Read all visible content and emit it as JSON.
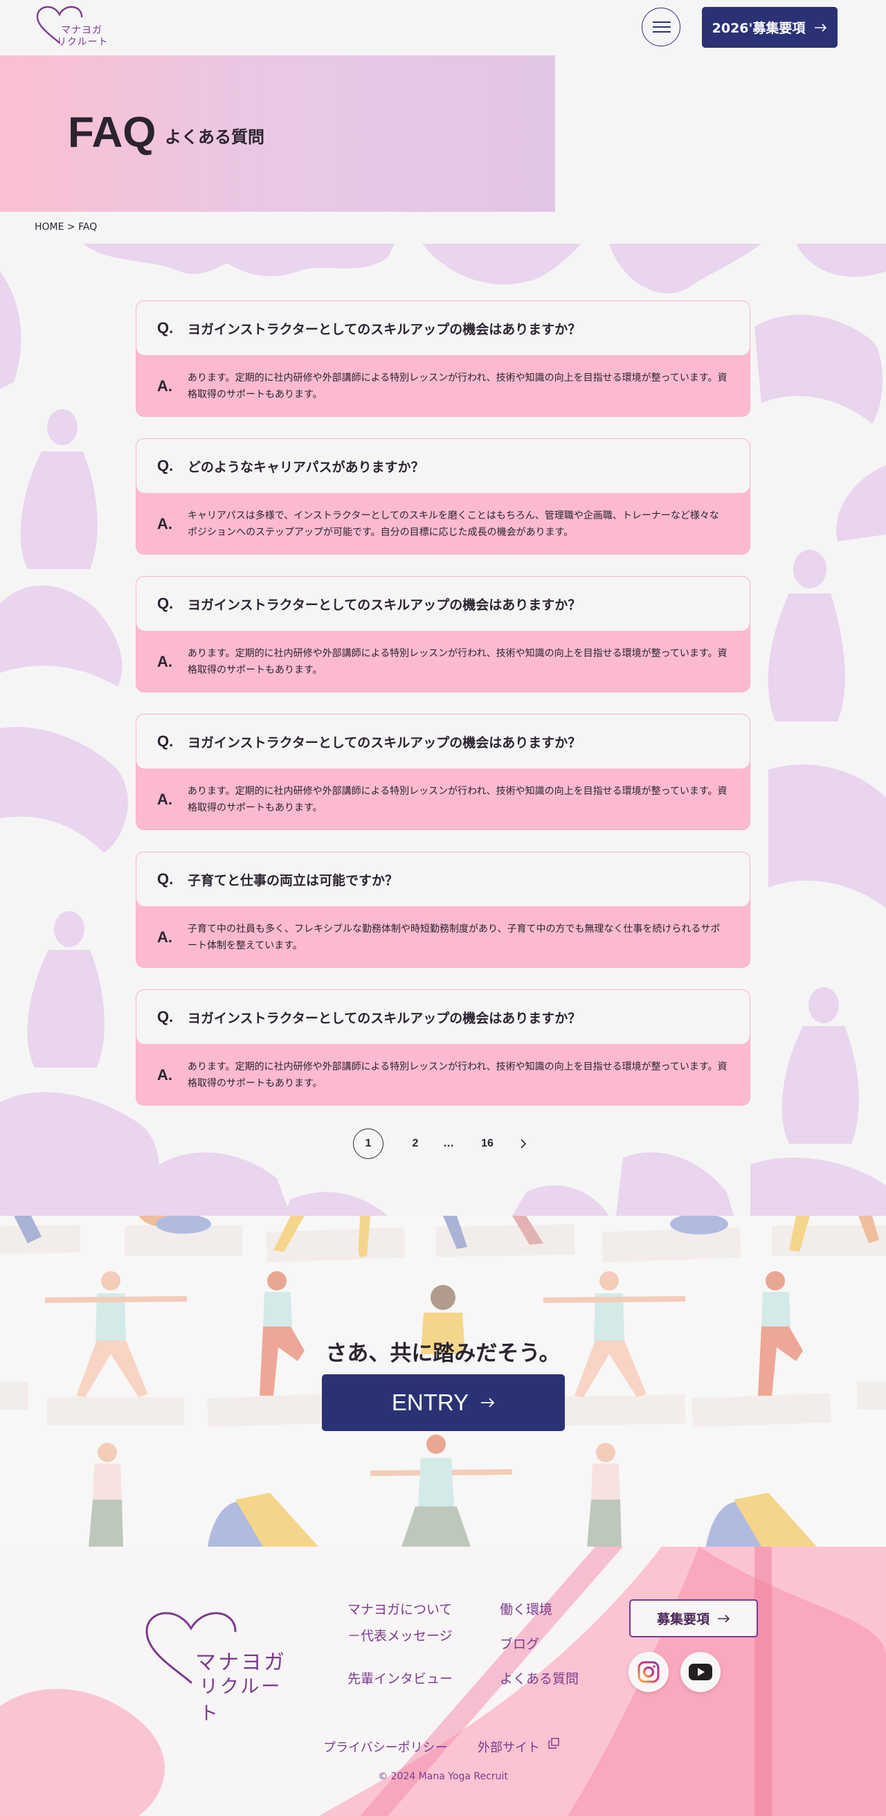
{
  "header": {
    "logo_text_line1": "マナヨガ",
    "logo_text_line2": "リクルート",
    "cta_label": "2026'募集要項"
  },
  "hero": {
    "title": "FAQ",
    "subtitle": "よくある質問"
  },
  "breadcrumb": "HOME > FAQ",
  "faq": [
    {
      "q_mark": "Q.",
      "question": "ヨガインストラクターとしてのスキルアップの機会はありますか？",
      "a_mark": "A.",
      "answer": "あります。定期的に社内研修や外部講師による特別レッスンが行われ、技術や知識の向上を目指せる環境が整っています。資格取得のサポートもあります。"
    },
    {
      "q_mark": "Q.",
      "question": "どのようなキャリアパスがありますか？",
      "a_mark": "A.",
      "answer": "キャリアパスは多様で、インストラクターとしてのスキルを磨くことはもちろん、管理職や企画職、トレーナーなど様々なポジションへのステップアップが可能です。自分の目標に応じた成長の機会があります。"
    },
    {
      "q_mark": "Q.",
      "question": "ヨガインストラクターとしてのスキルアップの機会はありますか？",
      "a_mark": "A.",
      "answer": "あります。定期的に社内研修や外部講師による特別レッスンが行われ、技術や知識の向上を目指せる環境が整っています。資格取得のサポートもあります。"
    },
    {
      "q_mark": "Q.",
      "question": "ヨガインストラクターとしてのスキルアップの機会はありますか？",
      "a_mark": "A.",
      "answer": "あります。定期的に社内研修や外部講師による特別レッスンが行われ、技術や知識の向上を目指せる環境が整っています。資格取得のサポートもあります。"
    },
    {
      "q_mark": "Q.",
      "question": "子育てと仕事の両立は可能ですか？",
      "a_mark": "A.",
      "answer": "子育て中の社員も多く、フレキシブルな勤務体制や時短勤務制度があり、子育て中の方でも無理なく仕事を続けられるサポート体制を整えています。"
    },
    {
      "q_mark": "Q.",
      "question": "ヨガインストラクターとしてのスキルアップの機会はありますか？",
      "a_mark": "A.",
      "answer": "あります。定期的に社内研修や外部講師による特別レッスンが行われ、技術や知識の向上を目指せる環境が整っています。資格取得のサポートもあります。"
    }
  ],
  "pagination": {
    "pages": [
      "1",
      "2",
      "…",
      "16"
    ],
    "current": "1",
    "next_icon": "chevron-right-icon"
  },
  "entry": {
    "headline": "さあ、共に踏みだそう。",
    "button_label": "ENTRY"
  },
  "footer": {
    "logo_line1": "マナヨガ",
    "logo_line2": "リクルート",
    "links": {
      "about": "マナヨガについて",
      "message": "－代表メッセージ",
      "interview": "先輩インタビュー",
      "environment": "働く環境",
      "blog": "ブログ",
      "faq": "よくある質問"
    },
    "recruit_button": "募集要項",
    "sns": [
      "instagram-icon",
      "youtube-icon"
    ],
    "privacy": "プライバシーポリシー",
    "external": "外部サイト",
    "copyright": "© 2024 Mana Yoga Recruit"
  },
  "colors": {
    "navy": "#2a3275",
    "pink": "#fcbad0",
    "purple": "#7a3c8c",
    "lavender": "#e2c6e6"
  }
}
